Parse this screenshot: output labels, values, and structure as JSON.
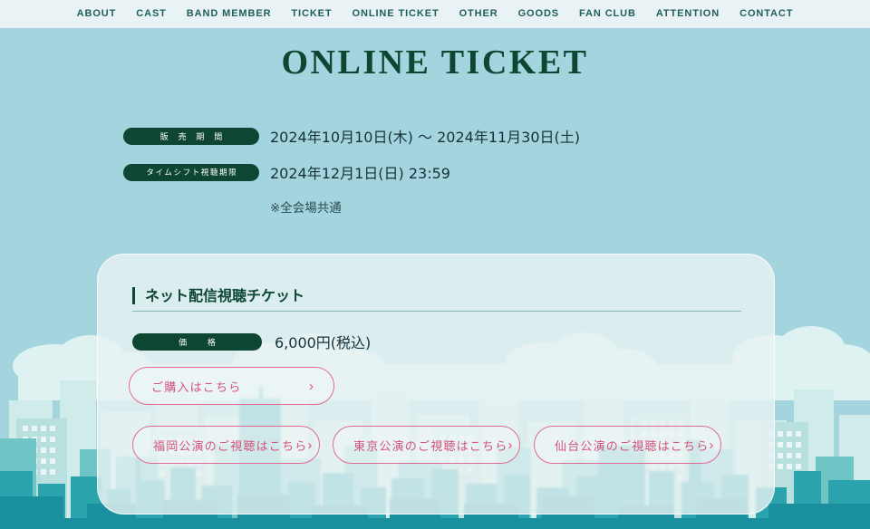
{
  "nav": {
    "items": [
      {
        "label": "ABOUT",
        "name": "about"
      },
      {
        "label": "CAST",
        "name": "cast"
      },
      {
        "label": "BAND MEMBER",
        "name": "band-member"
      },
      {
        "label": "TICKET",
        "name": "ticket"
      },
      {
        "label": "ONLINE TICKET",
        "name": "online-ticket"
      },
      {
        "label": "OTHER",
        "name": "other"
      },
      {
        "label": "GOODS",
        "name": "goods"
      },
      {
        "label": "FAN CLUB",
        "name": "fan-club"
      },
      {
        "label": "ATTENTION",
        "name": "attention"
      },
      {
        "label": "CONTACT",
        "name": "contact"
      }
    ]
  },
  "page": {
    "title": "ONLINE TICKET"
  },
  "info": {
    "rows": [
      {
        "label": "販 売 期 間",
        "value": "2024年10月10日(木) 〜 2024年11月30日(土)"
      },
      {
        "label": "タイムシフト視聴期限",
        "value": "2024年12月1日(日) 23:59"
      }
    ],
    "note": "※全会場共通"
  },
  "card": {
    "heading": "ネット配信視聴チケット",
    "price_label": "価 格",
    "price_value": "6,000円(税込)",
    "purchase_button": {
      "label": "ご購入はこちら",
      "chevron": "›"
    },
    "view_buttons": [
      {
        "label": "福岡公演のご視聴はこちら",
        "chevron": "›"
      },
      {
        "label": "東京公演のご視聴はこちら",
        "chevron": "›"
      },
      {
        "label": "仙台公演のご視聴はこちら",
        "chevron": "›"
      }
    ]
  },
  "colors": {
    "background": "#a4d4de",
    "navbar_bg": "#e9f3f5",
    "brand_green": "#0d4733",
    "accent_pink": "#d4537e",
    "card_bg": "#e9f3f3",
    "city_teal": "#1a97a8"
  }
}
